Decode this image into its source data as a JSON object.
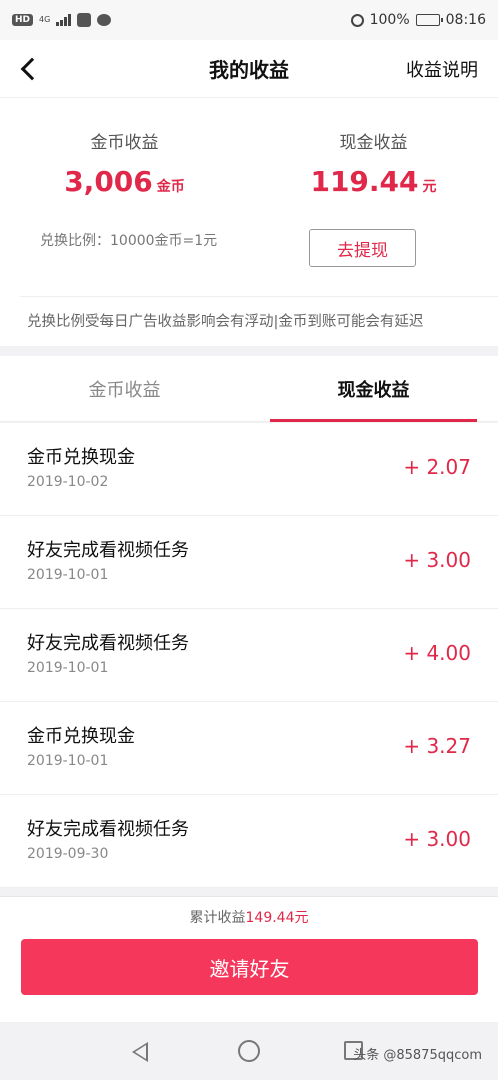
{
  "status_bar": {
    "hd_badge": "HD",
    "network": "4G",
    "battery": "100%",
    "time": "08:16",
    "icons": [
      "signal-icon",
      "app-icon",
      "chat-icon",
      "alarm-icon",
      "battery-icon"
    ]
  },
  "header": {
    "title": "我的收益",
    "right_link": "收益说明"
  },
  "summary": {
    "coin_label": "金币收益",
    "coin_value": "3,006",
    "coin_unit": "金币",
    "cash_label": "现金收益",
    "cash_value": "119.44",
    "cash_unit": "元",
    "rate_text": "兑换比例：10000金币=1元",
    "withdraw_label": "去提现",
    "notice": "兑换比例受每日广告收益影响会有浮动|金币到账可能会有延迟"
  },
  "tabs": [
    {
      "label": "金币收益",
      "active": false
    },
    {
      "label": "现金收益",
      "active": true
    }
  ],
  "records": [
    {
      "title": "金币兑换现金",
      "date": "2019-10-02",
      "amount": "+ 2.07"
    },
    {
      "title": "好友完成看视频任务",
      "date": "2019-10-01",
      "amount": "+ 3.00"
    },
    {
      "title": "好友完成看视频任务",
      "date": "2019-10-01",
      "amount": "+ 4.00"
    },
    {
      "title": "金币兑换现金",
      "date": "2019-10-01",
      "amount": "+ 3.27"
    },
    {
      "title": "好友完成看视频任务",
      "date": "2019-09-30",
      "amount": "+ 3.00"
    }
  ],
  "footer": {
    "total_label": "累计收益",
    "total_value": "149.44元",
    "invite_label": "邀请好友"
  },
  "watermark": "头条 @85875qqcom",
  "colors": {
    "accent": "#e0294a",
    "button": "#f5375c"
  }
}
